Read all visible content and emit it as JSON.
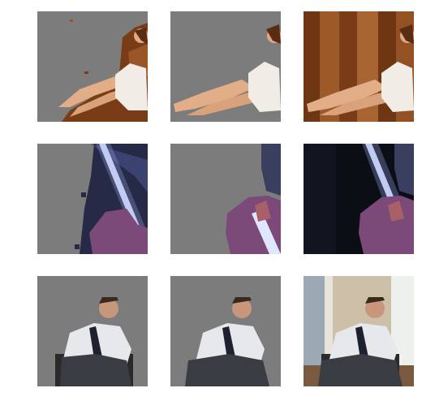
{
  "grid": {
    "rows": [
      {
        "subject": "woman-reclining",
        "columns": [
          "prediction-mask",
          "ground-truth-mask",
          "original-photo"
        ]
      },
      {
        "subject": "person-with-light-saber",
        "columns": [
          "prediction-mask",
          "ground-truth-mask",
          "original-photo"
        ]
      },
      {
        "subject": "man-in-chair",
        "columns": [
          "prediction-mask",
          "ground-truth-mask",
          "original-photo"
        ]
      }
    ]
  },
  "colors": {
    "background": "#ffffff",
    "mask_gray": "#7c7c7c",
    "wood": "#8a4a1e",
    "dark_room": "#0c0e16",
    "light_room": "#cdbfa8"
  }
}
